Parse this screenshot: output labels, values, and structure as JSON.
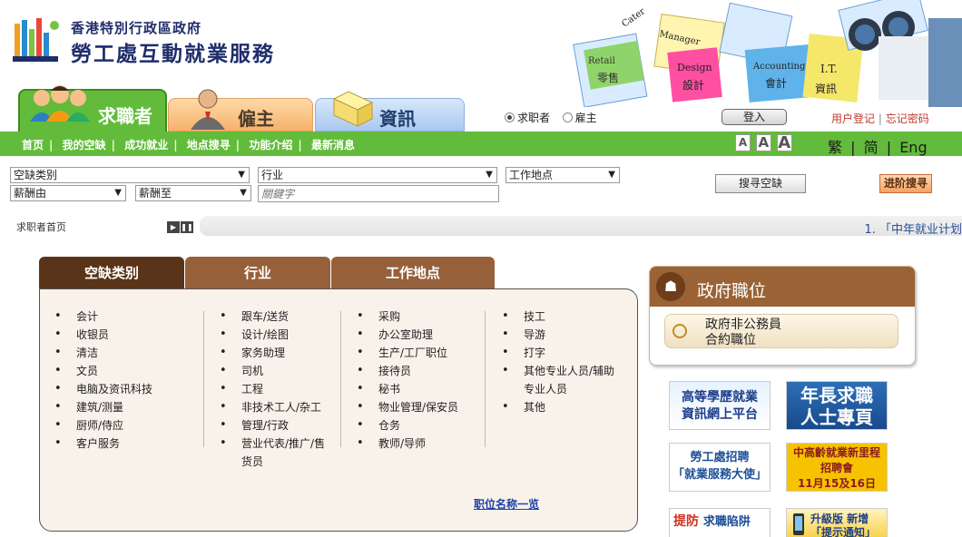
{
  "header": {
    "org_name_small": "香港特別行政區政府",
    "org_name_large": "勞工處互動就業服務",
    "banner_cards": [
      "Retail",
      "零售",
      "Design",
      "設計",
      "Accounting",
      "會計",
      "I.T.",
      "資訊",
      "Manager",
      "Cater"
    ]
  },
  "main_tabs": [
    {
      "label": "求職者",
      "icon": "job-seeker-people-icon",
      "active": true
    },
    {
      "label": "僱主",
      "icon": "employer-person-icon",
      "active": false
    },
    {
      "label": "資訊",
      "icon": "information-folder-icon",
      "active": false
    }
  ],
  "login": {
    "role_seeker": "求职者",
    "role_employer": "雇主",
    "selected_role": "求职者",
    "login_button": "登入",
    "user_register": "用户登记",
    "forgot_password": "忘记密码",
    "separator": "|"
  },
  "nav": {
    "links": [
      "首页",
      "我的空缺",
      "成功就业",
      "地点搜寻",
      "功能介绍",
      "最新消息"
    ],
    "separator": "|",
    "font_sizes": [
      "A",
      "A",
      "A"
    ],
    "languages": [
      "繁",
      "简",
      "Eng"
    ],
    "lang_separator": "|"
  },
  "search": {
    "category_select": "空缺类别",
    "industry_select": "行业",
    "location_select": "工作地点",
    "salary_from_select": "薪酬由",
    "salary_to_select": "薪酬至",
    "keyword_placeholder": "關鍵字",
    "search_button": "搜寻空缺",
    "advanced_button": "进阶搜寻"
  },
  "breadcrumb": {
    "current": "求职者首页",
    "ticker_text": "1. 「中年就业计划"
  },
  "category_tabs": [
    "空缺类别",
    "行业",
    "工作地点"
  ],
  "categories": {
    "col1": [
      "会计",
      "收银员",
      "清洁",
      "文员",
      "电脑及资讯科技",
      "建筑/测量",
      "厨师/侍应",
      "客户服务"
    ],
    "col2": [
      "跟车/送货",
      "设计/绘图",
      "家务助理",
      "司机",
      "工程",
      "非技术工人/杂工",
      "管理/行政",
      "营业代表/推广/售",
      "货员"
    ],
    "col3": [
      "采购",
      "办公室助理",
      "生产/工厂职位",
      "接待员",
      "秘书",
      "物业管理/保安员",
      "仓务",
      "教师/导师"
    ],
    "col4": [
      "技工",
      "导游",
      "打字",
      "其他专业人员/辅助",
      "专业人员",
      "其他"
    ],
    "job_title_link": "职位名称一览"
  },
  "gov_jobs": {
    "title": "政府職位",
    "button_line1": "政府非公務員",
    "button_line2": "合約職位"
  },
  "promos": [
    {
      "line1": "高等學歷就業",
      "line2": "資訊網上平台"
    },
    {
      "line1": "年長求職",
      "line2": "人士專頁"
    },
    {
      "line1": "勞工處招聘",
      "line2": "「就業服務大使」"
    },
    {
      "line1": "中高齡就業新里程",
      "line2": "招聘會",
      "line3": "11月15及16日"
    },
    {
      "line1": "提防",
      "line2": "求職陷阱"
    },
    {
      "line1": "升級版 新增",
      "line2": "「提示通知」"
    }
  ],
  "colors": {
    "nav_green": "#62bb3a",
    "tab_brown_dark": "#5a3418",
    "tab_brown": "#96603a",
    "brand_blue": "#1f2d6b",
    "link_red": "#c0392b"
  }
}
